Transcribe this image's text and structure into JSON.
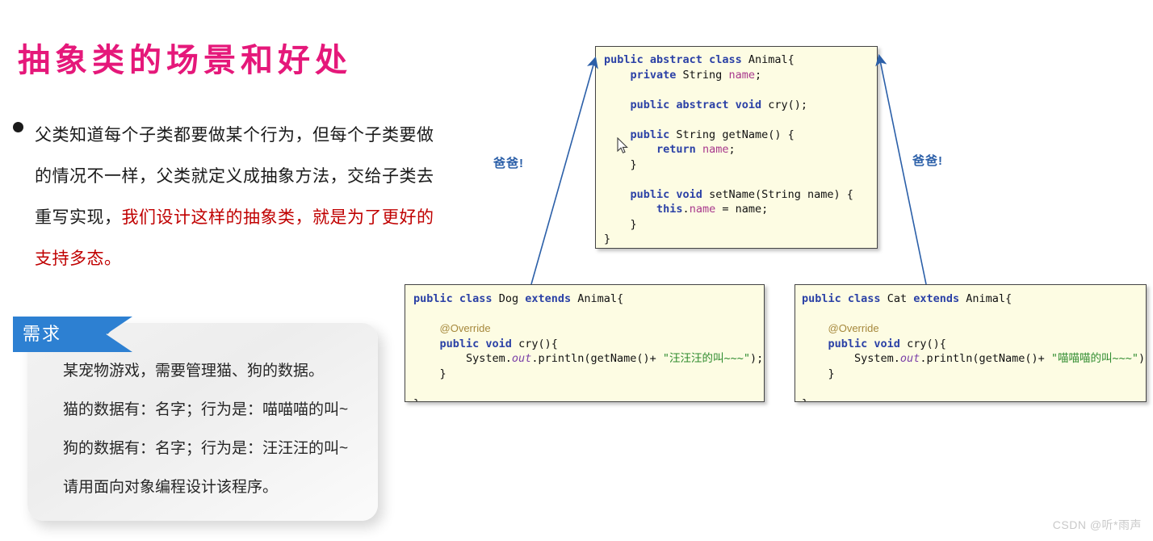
{
  "slide": {
    "title": "抽象类的场景和好处",
    "title_color": "#e5187a",
    "background": "#ffffff"
  },
  "bullet": {
    "marker": "bullet-dot",
    "text_normal_1": "父类知道每个子类都要做某个行为，但每个子类要做的情况不一样，父类就定义成抽象方法，交给子类去重写实现，",
    "text_highlight": "我们设计这样的抽象类，就是为了更好的支持多态。",
    "highlight_color": "#c00000"
  },
  "requirement_card": {
    "ribbon_label": "需求",
    "ribbon_color": "#2d80d2",
    "lines": [
      "某宠物游戏，需要管理猫、狗的数据。",
      "猫的数据有：名字；行为是：喵喵喵的叫~",
      "狗的数据有：名字；行为是：汪汪汪的叫~",
      "请用面向对象编程设计该程序。"
    ]
  },
  "code_boxes": {
    "animal": {
      "name": "Animal",
      "background": "#fdfce3",
      "lines": [
        [
          {
            "t": "public ",
            "c": "kw"
          },
          {
            "t": "abstract ",
            "c": "kw"
          },
          {
            "t": "class ",
            "c": "kw"
          },
          {
            "t": "Animal{",
            "c": "plain"
          }
        ],
        [
          {
            "t": "    ",
            "c": "plain"
          },
          {
            "t": "private ",
            "c": "kw"
          },
          {
            "t": "String ",
            "c": "plain"
          },
          {
            "t": "name",
            "c": "fld"
          },
          {
            "t": ";",
            "c": "plain"
          }
        ],
        [
          {
            "t": " ",
            "c": "plain"
          }
        ],
        [
          {
            "t": "    ",
            "c": "plain"
          },
          {
            "t": "public ",
            "c": "kw"
          },
          {
            "t": "abstract ",
            "c": "kw"
          },
          {
            "t": "void ",
            "c": "kw"
          },
          {
            "t": "cry();",
            "c": "plain"
          }
        ],
        [
          {
            "t": " ",
            "c": "plain"
          }
        ],
        [
          {
            "t": "    ",
            "c": "plain"
          },
          {
            "t": "public ",
            "c": "kw"
          },
          {
            "t": "String getName() {",
            "c": "plain"
          }
        ],
        [
          {
            "t": "        ",
            "c": "plain"
          },
          {
            "t": "return ",
            "c": "kw"
          },
          {
            "t": "name",
            "c": "fld"
          },
          {
            "t": ";",
            "c": "plain"
          }
        ],
        [
          {
            "t": "    }",
            "c": "plain"
          }
        ],
        [
          {
            "t": " ",
            "c": "plain"
          }
        ],
        [
          {
            "t": "    ",
            "c": "plain"
          },
          {
            "t": "public ",
            "c": "kw"
          },
          {
            "t": "void ",
            "c": "kw"
          },
          {
            "t": "setName(String name) {",
            "c": "plain"
          }
        ],
        [
          {
            "t": "        ",
            "c": "plain"
          },
          {
            "t": "this",
            "c": "kw"
          },
          {
            "t": ".",
            "c": "plain"
          },
          {
            "t": "name",
            "c": "fld"
          },
          {
            "t": " = name;",
            "c": "plain"
          }
        ],
        [
          {
            "t": "    }",
            "c": "plain"
          }
        ],
        [
          {
            "t": "}",
            "c": "plain"
          }
        ]
      ]
    },
    "dog": {
      "name": "Dog",
      "background": "#fdfce3",
      "lines": [
        [
          {
            "t": "public ",
            "c": "kw"
          },
          {
            "t": "class ",
            "c": "kw"
          },
          {
            "t": "Dog ",
            "c": "plain"
          },
          {
            "t": "extends ",
            "c": "kw"
          },
          {
            "t": "Animal{",
            "c": "plain"
          }
        ],
        [
          {
            "t": " ",
            "c": "plain"
          }
        ],
        [
          {
            "t": "    ",
            "c": "plain"
          },
          {
            "t": "@Override",
            "c": "ann"
          }
        ],
        [
          {
            "t": "    ",
            "c": "plain"
          },
          {
            "t": "public ",
            "c": "kw"
          },
          {
            "t": "void ",
            "c": "kw"
          },
          {
            "t": "cry(){",
            "c": "plain"
          }
        ],
        [
          {
            "t": "        System.",
            "c": "plain"
          },
          {
            "t": "out",
            "c": "ital"
          },
          {
            "t": ".println(getName()+ ",
            "c": "plain"
          },
          {
            "t": "\"汪汪汪的叫~~~\"",
            "c": "str"
          },
          {
            "t": ");",
            "c": "plain"
          }
        ],
        [
          {
            "t": "    }",
            "c": "plain"
          }
        ],
        [
          {
            "t": " ",
            "c": "plain"
          }
        ],
        [
          {
            "t": "}",
            "c": "plain"
          }
        ]
      ]
    },
    "cat": {
      "name": "Cat",
      "background": "#fdfce3",
      "lines": [
        [
          {
            "t": "public ",
            "c": "kw"
          },
          {
            "t": "class ",
            "c": "kw"
          },
          {
            "t": "Cat ",
            "c": "plain"
          },
          {
            "t": "extends ",
            "c": "kw"
          },
          {
            "t": "Animal{",
            "c": "plain"
          }
        ],
        [
          {
            "t": " ",
            "c": "plain"
          }
        ],
        [
          {
            "t": "    ",
            "c": "plain"
          },
          {
            "t": "@Override",
            "c": "ann"
          }
        ],
        [
          {
            "t": "    ",
            "c": "plain"
          },
          {
            "t": "public ",
            "c": "kw"
          },
          {
            "t": "void ",
            "c": "kw"
          },
          {
            "t": "cry(){",
            "c": "plain"
          }
        ],
        [
          {
            "t": "        System.",
            "c": "plain"
          },
          {
            "t": "out",
            "c": "ital"
          },
          {
            "t": ".println(getName()+ ",
            "c": "plain"
          },
          {
            "t": "\"喵喵喵的叫~~~\"",
            "c": "str"
          },
          {
            "t": ");",
            "c": "plain"
          }
        ],
        [
          {
            "t": "    }",
            "c": "plain"
          }
        ],
        [
          {
            "t": " ",
            "c": "plain"
          }
        ],
        [
          {
            "t": "}",
            "c": "plain"
          }
        ]
      ]
    }
  },
  "arrows": {
    "color": "#2b5fa8",
    "left_label": "爸爸!",
    "right_label": "爸爸!"
  },
  "watermark": "CSDN @听*雨声"
}
